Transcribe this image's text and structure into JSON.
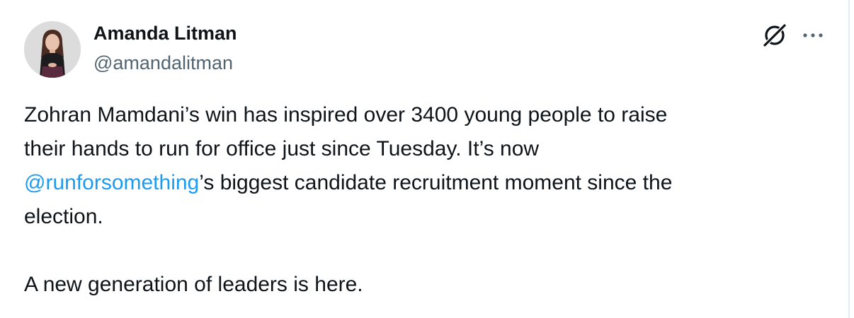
{
  "author": {
    "display_name": "Amanda Litman",
    "handle": "@amandalitman"
  },
  "icons": {
    "grok": "grok-icon",
    "more": "more-horizontal-icon",
    "avatar": "profile-photo"
  },
  "tweet": {
    "line1": "Zohran Mamdani’s win has inspired over 3400 young people to raise",
    "line2": "their hands to run for office just since Tuesday. It’s now",
    "mention": "@runforsomething",
    "line3_rest": "’s biggest candidate recruitment moment since the",
    "line4": "election.",
    "line5": "A new generation of leaders is here."
  },
  "colors": {
    "text": "#0f1419",
    "secondary": "#536471",
    "link": "#1d9bf0"
  }
}
